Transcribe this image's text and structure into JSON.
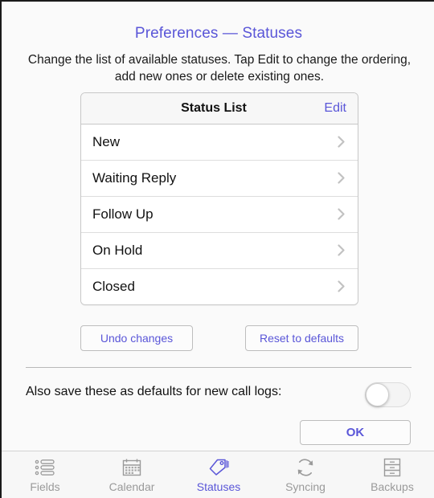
{
  "header": {
    "title": "Preferences — Statuses",
    "description": "Change the list of available statuses.  Tap Edit to change the ordering, add new ones or delete existing ones."
  },
  "status_card": {
    "title": "Status List",
    "edit_label": "Edit",
    "rows": [
      {
        "label": "New",
        "chevron": "chevron-right-icon"
      },
      {
        "label": "Waiting Reply",
        "chevron": "chevron-right-icon"
      },
      {
        "label": "Follow Up",
        "chevron": "chevron-right-icon"
      },
      {
        "label": "On Hold",
        "chevron": "chevron-right-icon"
      },
      {
        "label": "Closed",
        "chevron": "chevron-right-icon"
      }
    ]
  },
  "actions": {
    "undo_label": "Undo changes",
    "reset_label": "Reset to defaults",
    "ok_label": "OK"
  },
  "defaults_option": {
    "label": "Also save these as defaults for new call logs:",
    "toggle_state": "off"
  },
  "tabbar": {
    "items": [
      {
        "label": "Fields",
        "icon": "list-bullets-icon",
        "active": false
      },
      {
        "label": "Calendar",
        "icon": "calendar-icon",
        "active": false
      },
      {
        "label": "Statuses",
        "icon": "tag-icon",
        "active": true
      },
      {
        "label": "Syncing",
        "icon": "refresh-sync-icon",
        "active": false
      },
      {
        "label": "Backups",
        "icon": "file-cabinet-icon",
        "active": false
      }
    ]
  },
  "colors": {
    "accent": "#5a56d8",
    "text": "#111111",
    "muted": "#9a9a9a",
    "background": "#fafafa",
    "card": "#ffffff",
    "border": "#c8c8c8"
  }
}
